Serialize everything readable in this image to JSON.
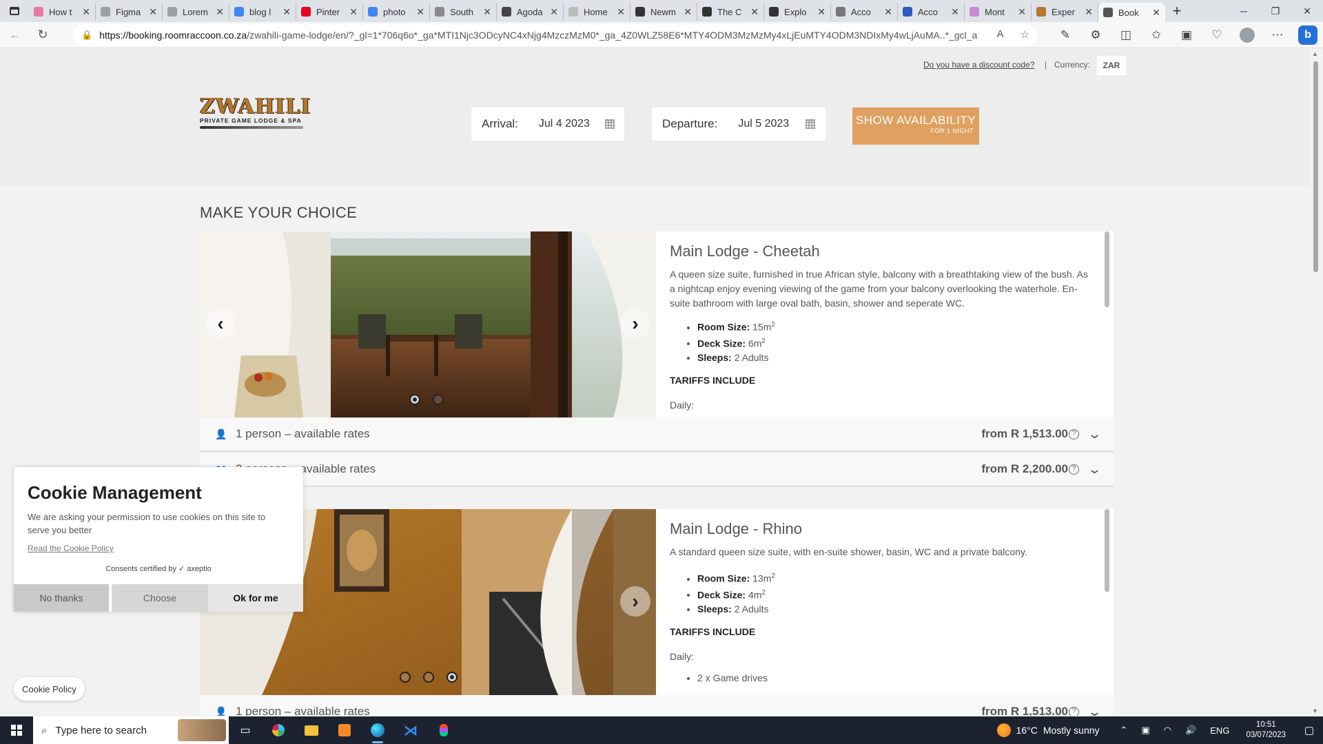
{
  "browser": {
    "tabs": [
      {
        "title": "How t",
        "color": "#e67aa3"
      },
      {
        "title": "Figma",
        "color": "#9aa0a6"
      },
      {
        "title": "Lorem",
        "color": "#9aa0a6"
      },
      {
        "title": "blog l",
        "color": "#4285f4"
      },
      {
        "title": "Pinter",
        "color": "#e60023"
      },
      {
        "title": "photo",
        "color": "#4285f4"
      },
      {
        "title": "South",
        "color": "#8a8a8a"
      },
      {
        "title": "Agoda",
        "color": "#444444"
      },
      {
        "title": "Home",
        "color": "#bbbbbb"
      },
      {
        "title": "Newm",
        "color": "#333333"
      },
      {
        "title": "The C",
        "color": "#333333"
      },
      {
        "title": "Explo",
        "color": "#333333"
      },
      {
        "title": "Acco",
        "color": "#777777"
      },
      {
        "title": "Acco",
        "color": "#2d5bb8"
      },
      {
        "title": "Mont",
        "color": "#c58bd4"
      },
      {
        "title": "Exper",
        "color": "#b5782f"
      },
      {
        "title": "Book",
        "color": "#555555",
        "active": true
      }
    ],
    "url_host": "https://booking.roomraccoon.co.za",
    "url_path": "/zwahili-game-lodge/en/?_gl=1*706q6o*_ga*MTI1Njc3ODcyNC4xNjg4MzczMzM0*_ga_4Z0WLZ58E6*MTY4ODM3MzMzMy4xLjEuMTY4ODM3NDIxMy4wLjAuMA..*_gcl_a..."
  },
  "header": {
    "discount_link": "Do you have a discount code?",
    "separator": "|",
    "currency_label": "Currency:",
    "currency_value": "ZAR",
    "logo_main": "ZWAHILI",
    "logo_sub": "PRIVATE GAME LODGE & SPA",
    "arrival_label": "Arrival:",
    "arrival_value": "Jul 4 2023",
    "departure_label": "Departure:",
    "departure_value": "Jul 5 2023",
    "show_button": "SHOW AVAILABILITY",
    "show_button_sub": "FOR 1 NIGHT"
  },
  "section_title": "MAKE YOUR CHOICE",
  "rooms": [
    {
      "name": "Main Lodge - Cheetah",
      "description": "A queen size suite, furnished in true African style, balcony with a breathtaking view of the bush. As a nightcap enjoy evening viewing of the game from your balcony overlooking the waterhole. En-suite bathroom with large oval bath, basin, shower and seperate WC.",
      "room_size_label": "Room Size:",
      "room_size": "15m",
      "deck_size_label": "Deck Size:",
      "deck_size": "6m",
      "sleeps_label": "Sleeps:",
      "sleeps": "2 Adults",
      "tariffs_label": "TARIFFS INCLUDE",
      "daily_label": "Daily:",
      "rates": [
        {
          "label": "1 person – available rates",
          "price": "from R 1,513.00"
        },
        {
          "label": "2 persons – available rates",
          "price": "from R 2,200.00"
        }
      ]
    },
    {
      "name": "Main Lodge - Rhino",
      "description": "A standard queen size suite, with en-suite shower, basin, WC and a private balcony.",
      "room_size_label": "Room Size:",
      "room_size": "13m",
      "deck_size_label": "Deck Size:",
      "deck_size": "4m",
      "sleeps_label": "Sleeps:",
      "sleeps": "2 Adults",
      "tariffs_label": "TARIFFS INCLUDE",
      "daily_label": "Daily:",
      "daily_item": "2 x Game drives",
      "rates": [
        {
          "label": "1 person – available rates",
          "price": "from R 1,513.00"
        }
      ]
    }
  ],
  "sup": "2",
  "cookie": {
    "title": "Cookie Management",
    "message": "We are asking your permission to use cookies on this site to serve you better",
    "policy_link": "Read the Cookie Policy",
    "certified": "Consents certified by ✓ axeptio",
    "no_thanks": "No thanks",
    "choose": "Choose",
    "ok": "Ok for me",
    "policy_button": "Cookie Policy"
  },
  "taskbar": {
    "search_placeholder": "Type here to search",
    "temperature": "16°C",
    "weather": "Mostly sunny",
    "language": "ENG",
    "time": "10:51",
    "date": "03/07/2023"
  }
}
